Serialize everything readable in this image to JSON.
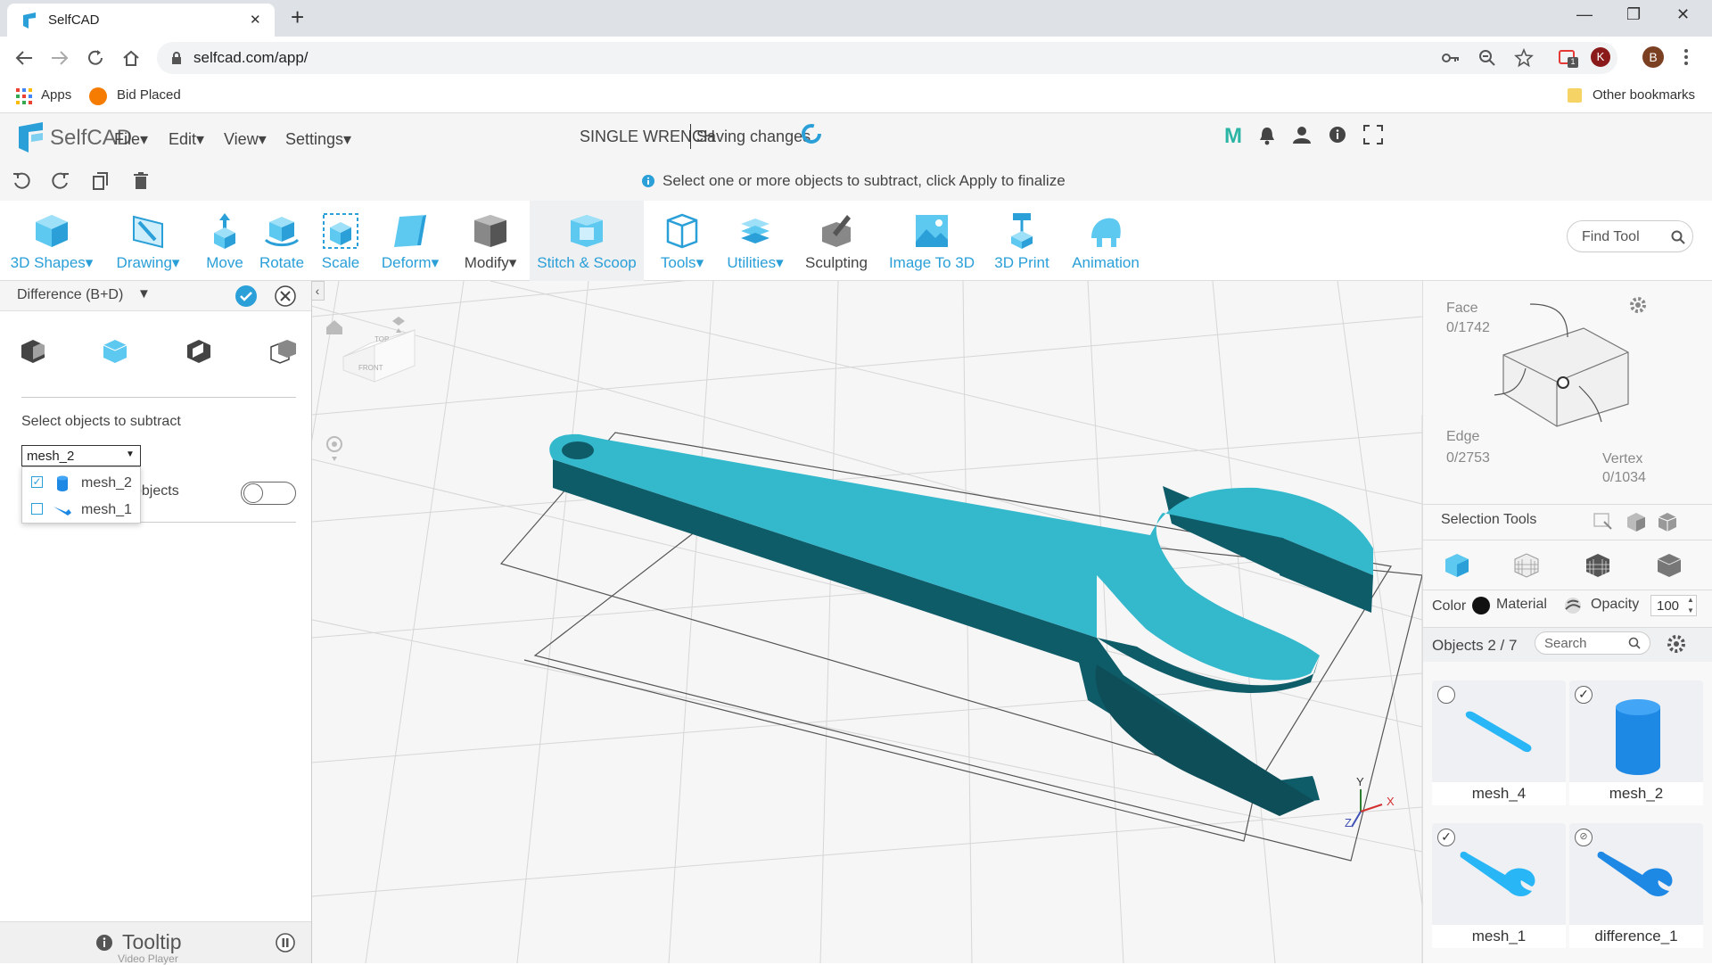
{
  "browser": {
    "tab_title": "SelfCAD",
    "new_tab": "+",
    "url": "selfcad.com/app/",
    "profile_initial": "B",
    "ext_initial": "K",
    "window_min": "—",
    "window_restore": "❐",
    "window_close": "✕",
    "tab_close": "✕"
  },
  "bookmarks": {
    "apps": "Apps",
    "bid_placed": "Bid Placed",
    "other": "Other bookmarks"
  },
  "app": {
    "brand": "SelfCAD",
    "menus": [
      "File",
      "Edit",
      "View",
      "Settings"
    ],
    "project_title": "SINGLE WRENCH",
    "save_status": "Saving changes",
    "hint": "Select one or more objects to subtract, click Apply to finalize",
    "m_badge": "M"
  },
  "toolbar": {
    "tools": [
      {
        "label": "3D Shapes",
        "caret": true
      },
      {
        "label": "Drawing",
        "caret": true
      },
      {
        "label": "Move",
        "caret": false
      },
      {
        "label": "Rotate",
        "caret": false
      },
      {
        "label": "Scale",
        "caret": false
      },
      {
        "label": "Deform",
        "caret": true
      },
      {
        "label": "Modify",
        "caret": true
      },
      {
        "label": "Stitch & Scoop",
        "caret": false
      },
      {
        "label": "Tools",
        "caret": true
      },
      {
        "label": "Utilities",
        "caret": true
      },
      {
        "label": "Sculpting",
        "caret": false
      },
      {
        "label": "Image To 3D",
        "caret": false
      },
      {
        "label": "3D Print",
        "caret": false
      },
      {
        "label": "Animation",
        "caret": false
      }
    ],
    "find_placeholder": "Find Tool"
  },
  "left_panel": {
    "title": "Difference (B+D)",
    "select_label": "Select objects to subtract",
    "selected_value": "mesh_2",
    "dropdown_options": [
      {
        "label": "mesh_2",
        "checked": true
      },
      {
        "label": "mesh_1",
        "checked": false
      }
    ],
    "toggle_label_partial": "objects",
    "tooltip_label": "Tooltip",
    "video_player": "Video Player"
  },
  "viewport": {
    "cube_top": "TOP",
    "cube_front": "FRONT",
    "axis_x": "X",
    "axis_y": "Y",
    "axis_z": "Z"
  },
  "right_panel": {
    "face_label": "Face",
    "face_count": "0/1742",
    "edge_label": "Edge",
    "edge_count": "0/2753",
    "vertex_label": "Vertex",
    "vertex_count": "0/1034",
    "selection_tools": "Selection Tools",
    "color_label": "Color",
    "material_label": "Material",
    "opacity_label": "Opacity",
    "opacity_value": "100",
    "objects_label": "Objects 2 / 7",
    "search_placeholder": "Search",
    "objects": [
      {
        "name": "mesh_4",
        "state": "unchecked"
      },
      {
        "name": "mesh_2",
        "state": "checked"
      },
      {
        "name": "mesh_1",
        "state": "checked"
      },
      {
        "name": "difference_1",
        "state": "hidden"
      }
    ]
  },
  "colors": {
    "accent": "#2a9fd8",
    "wrench_top": "#33b8cc",
    "wrench_side": "#0f5c69",
    "panel_bg": "#f5f5f5"
  }
}
